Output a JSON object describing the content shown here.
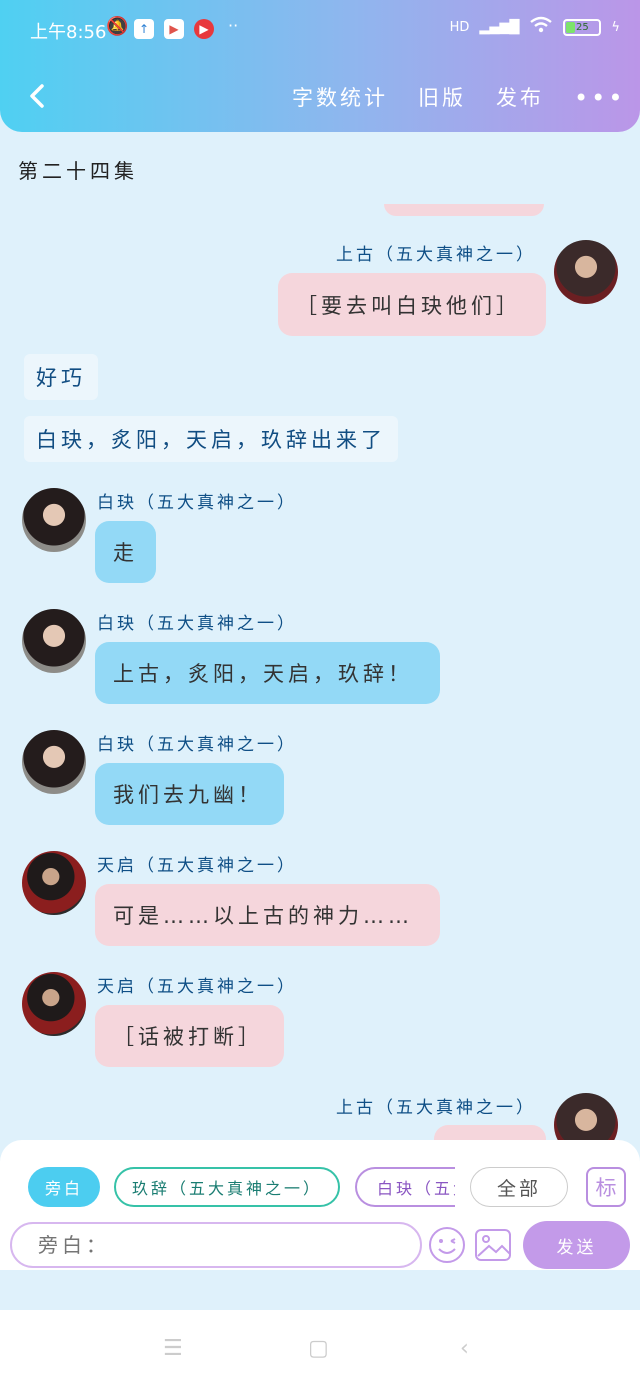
{
  "status": {
    "time": "上午8:56",
    "network": "HD",
    "battery": "25"
  },
  "header": {
    "back_icon": "chevron-left-icon",
    "word_count": "字数统计",
    "old_version": "旧版",
    "publish": "发布",
    "more": "•••"
  },
  "episode_title": "第二十四集",
  "chat": {
    "m1": {
      "name": "上古（五大真神之一）",
      "text": "［要去叫白玦他们］"
    },
    "n1": "好巧",
    "n2": "白玦，炙阳，天启，玖辞出来了",
    "m2": {
      "name": "白玦（五大真神之一）",
      "text": "走"
    },
    "m3": {
      "name": "白玦（五大真神之一）",
      "text": "上古，炙阳，天启，玖辞！"
    },
    "m4": {
      "name": "白玦（五大真神之一）",
      "text": "我们去九幽！"
    },
    "m5": {
      "name": "天启（五大真神之一）",
      "text": "可是……以上古的神力……"
    },
    "m6": {
      "name": "天启（五大真神之一）",
      "text": "［话被打断］"
    },
    "m7": {
      "name": "上古（五大真神之一）"
    }
  },
  "toolbar": {
    "chip_narration": "旁白",
    "chip_jiuci": "玖辞（五大真神之一）",
    "chip_baijue": "白玦（五大真神之一）",
    "chip_all": "全部",
    "tag": "标",
    "input_placeholder": "旁白：",
    "send": "发送"
  },
  "colors": {
    "header_gradient_start": "#4fd0f2",
    "header_gradient_end": "#bb96e8",
    "bubble_pink": "#f5d6dc",
    "bubble_blue": "#93d9f6",
    "name_color": "#0f4f86",
    "send_button": "#c39ae9"
  }
}
